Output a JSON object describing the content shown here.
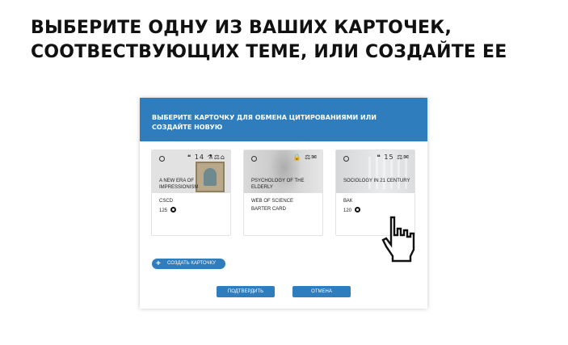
{
  "headline": {
    "line1": "ВЫБЕРИТЕ ОДНУ ИЗ ВАШИХ КАРТОЧЕК,",
    "line2": "СООТВЕСТВУЮЩИХ ТЕМЕ, ИЛИ СОЗДАЙТЕ ЕЕ"
  },
  "dialog": {
    "title_line1": "ВЫБЕРИТЕ КАРТОЧКУ ДЛЯ ОБМЕНА ЦИТИРОВАНИЯМИ ИЛИ",
    "title_line2": "СОЗДАЙТЕ НОВУЮ",
    "accent_color": "#2f7dbd",
    "cards": [
      {
        "title": "A NEW ERA OF IMPRESSIONISM",
        "source": "CSCD",
        "count": "125",
        "icons": "❝ 14 ⚗ ⚖ 🏛",
        "image": "portrait-painting"
      },
      {
        "title": "PSYCHOLOGY OF THE ELDERLY",
        "source": "WEB OF SCIENCE",
        "count": "",
        "extra": "BARTER CARD",
        "icons": "🔒 ⚖ 💬",
        "image": "blurred-person"
      },
      {
        "title": "SOCIOLOGY IN 21 CENTURY",
        "source": "ВАК",
        "count": "120",
        "icons": "❝ 15 ⚖ 💬",
        "image": "laboratory-glassware"
      }
    ],
    "create_button": "СОЗДАТЬ КАРТОЧКУ",
    "confirm_button": "ПОДТВЕРДИТЬ",
    "cancel_button": "ОТМЕНА"
  }
}
